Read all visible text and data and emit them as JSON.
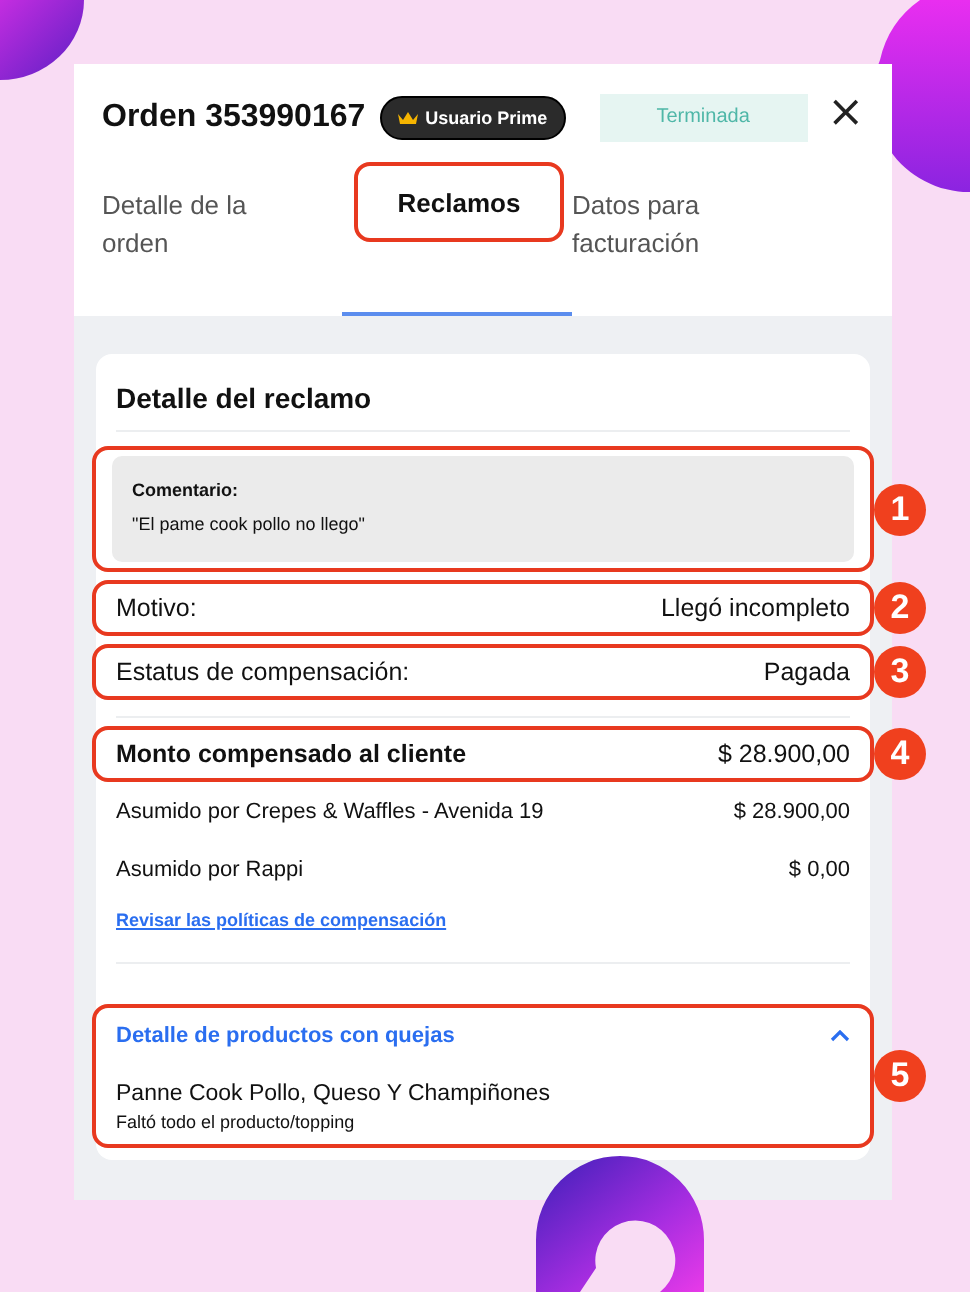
{
  "order": {
    "title": "Orden 353990167",
    "badge": "Usuario Prime",
    "status": "Terminada",
    "close": "×"
  },
  "tabs": [
    {
      "label": "Detalle de la orden",
      "selected": false,
      "annotated": false
    },
    {
      "label": "Reclamos",
      "selected": true,
      "annotated": true
    },
    {
      "label": "Datos para facturación",
      "selected": false,
      "annotated": false
    }
  ],
  "claim": {
    "title": "Detalle del reclamo",
    "comment": {
      "label": "Comentario:",
      "text": "\"El pame cook pollo no llego\"",
      "callout": "1"
    },
    "rows": [
      {
        "kind": "plain",
        "label": "Motivo:",
        "value": "Llegó incompleto",
        "callout": "2"
      },
      {
        "kind": "plain",
        "label": "Estatus de compensación:",
        "value": "Pagada",
        "callout": "3"
      },
      {
        "kind": "total",
        "label": "Monto compensado al cliente",
        "value": "$ 28.900,00",
        "callout": "4"
      },
      {
        "kind": "detail",
        "label": "Asumido por Crepes & Waffles - Avenida 19",
        "value": "$ 28.900,00"
      },
      {
        "kind": "detail",
        "label": "Asumido por Rappi",
        "value": "$ 0,00"
      }
    ],
    "link": "Revisar las políticas de compensación",
    "complaints": {
      "title": "Detalle de productos con quejas",
      "expanded": true,
      "callout": "5",
      "items": [
        {
          "name": "Panne Cook Pollo, Queso Y Champiñones",
          "detail": "Faltó todo el producto/topping"
        }
      ]
    }
  }
}
